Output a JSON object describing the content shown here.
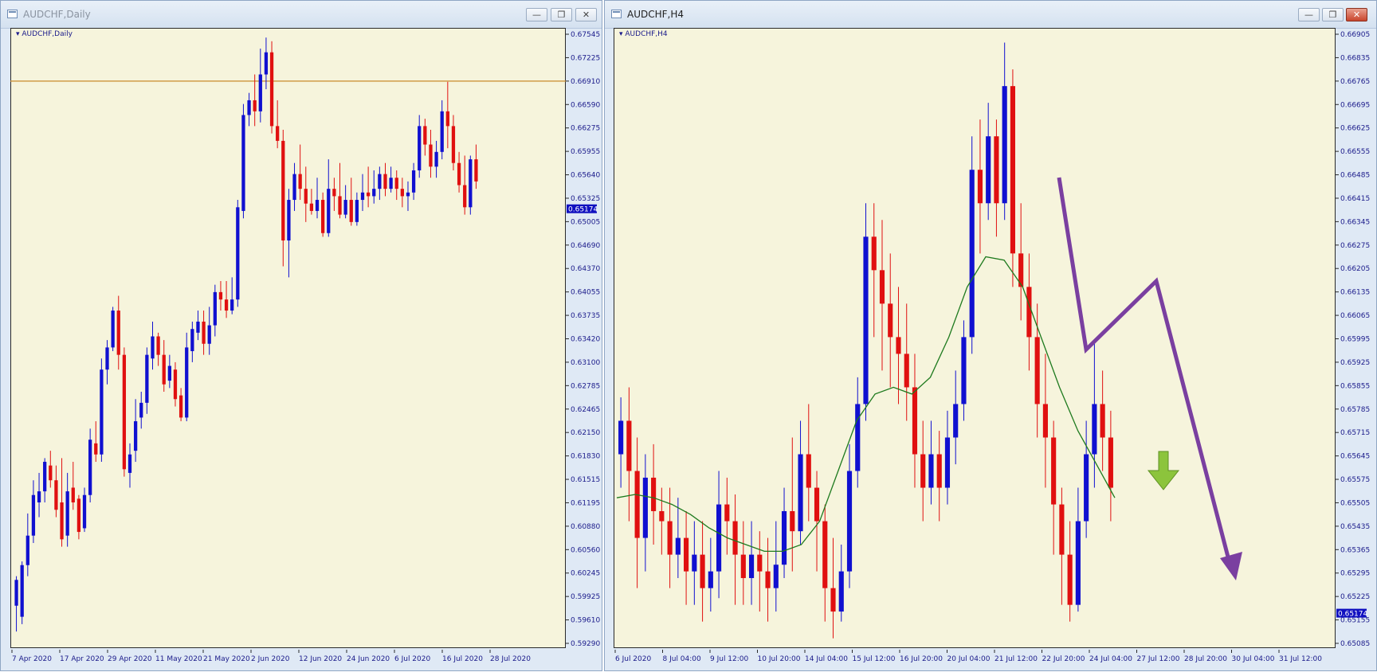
{
  "windows": {
    "left": {
      "title": "AUDCHF,Daily",
      "chart_label": "AUDCHF,Daily",
      "controls": [
        "minimize",
        "restore",
        "close"
      ]
    },
    "right": {
      "title": "AUDCHF,H4",
      "chart_label": "AUDCHF,H4",
      "controls": [
        "minimize",
        "restore",
        "close"
      ]
    }
  },
  "colors": {
    "background": "#f6f4dc",
    "bull_candle": "#1010d0",
    "bear_candle": "#e01010",
    "moving_average": "#1e7a1e",
    "annotation_arrow": "#7a3fa0",
    "signal_arrow": "#8cc43c",
    "horizontal_line": "#c98a2a",
    "price_tag": "#1010c0"
  },
  "chart_data": [
    {
      "type": "candlestick",
      "title": "AUDCHF,Daily",
      "price_axis": [
        "0.67545",
        "0.67225",
        "0.66910",
        "0.66590",
        "0.66275",
        "0.65955",
        "0.65640",
        "0.65325",
        "0.65005",
        "0.64690",
        "0.64370",
        "0.64055",
        "0.63735",
        "0.63420",
        "0.63100",
        "0.62785",
        "0.62465",
        "0.62150",
        "0.61830",
        "0.61515",
        "0.61195",
        "0.60880",
        "0.60560",
        "0.60245",
        "0.59925",
        "0.59610",
        "0.59290"
      ],
      "date_axis": [
        "7 Apr 2020",
        "17 Apr 2020",
        "29 Apr 2020",
        "11 May 2020",
        "21 May 2020",
        "2 Jun 2020",
        "12 Jun 2020",
        "24 Jun 2020",
        "6 Jul 2020",
        "16 Jul 2020",
        "28 Jul 2020"
      ],
      "ylim": [
        0.5929,
        0.67545
      ],
      "current_price": "0.65174",
      "horizontal_line": 0.6691,
      "candles": [
        [
          0.598,
          0.6015,
          0.5945,
          0.602,
          "up"
        ],
        [
          0.5965,
          0.6035,
          0.5955,
          0.604,
          "up"
        ],
        [
          0.6035,
          0.6075,
          0.602,
          0.6105,
          "up"
        ],
        [
          0.6075,
          0.613,
          0.6065,
          0.615,
          "up"
        ],
        [
          0.612,
          0.6135,
          0.61,
          0.616,
          "up"
        ],
        [
          0.6135,
          0.6175,
          0.612,
          0.618,
          "up"
        ],
        [
          0.617,
          0.615,
          0.614,
          0.619,
          "down"
        ],
        [
          0.615,
          0.611,
          0.61,
          0.617,
          "down"
        ],
        [
          0.612,
          0.607,
          0.606,
          0.618,
          "down"
        ],
        [
          0.6075,
          0.6135,
          0.606,
          0.616,
          "up"
        ],
        [
          0.614,
          0.612,
          0.611,
          0.6175,
          "down"
        ],
        [
          0.6125,
          0.608,
          0.607,
          0.613,
          "down"
        ],
        [
          0.6085,
          0.613,
          0.608,
          0.614,
          "up"
        ],
        [
          0.613,
          0.6205,
          0.612,
          0.622,
          "up"
        ],
        [
          0.62,
          0.6185,
          0.6175,
          0.623,
          "down"
        ],
        [
          0.6185,
          0.63,
          0.6175,
          0.6315,
          "up"
        ],
        [
          0.63,
          0.633,
          0.628,
          0.634,
          "up"
        ],
        [
          0.633,
          0.638,
          0.6325,
          0.6385,
          "up"
        ],
        [
          0.638,
          0.632,
          0.63,
          0.64,
          "down"
        ],
        [
          0.632,
          0.6165,
          0.6155,
          0.633,
          "down"
        ],
        [
          0.616,
          0.6185,
          0.614,
          0.62,
          "up"
        ],
        [
          0.619,
          0.623,
          0.6175,
          0.626,
          "up"
        ],
        [
          0.6235,
          0.6255,
          0.622,
          0.627,
          "up"
        ],
        [
          0.6255,
          0.632,
          0.624,
          0.633,
          "up"
        ],
        [
          0.6315,
          0.6345,
          0.63,
          0.6365,
          "up"
        ],
        [
          0.6345,
          0.632,
          0.6305,
          0.635,
          "down"
        ],
        [
          0.632,
          0.628,
          0.627,
          0.634,
          "down"
        ],
        [
          0.6285,
          0.6305,
          0.6275,
          0.632,
          "up"
        ],
        [
          0.63,
          0.626,
          0.625,
          0.631,
          "down"
        ],
        [
          0.6265,
          0.6235,
          0.623,
          0.6275,
          "down"
        ],
        [
          0.6235,
          0.633,
          0.623,
          0.635,
          "up"
        ],
        [
          0.6325,
          0.6355,
          0.631,
          0.6365,
          "up"
        ],
        [
          0.635,
          0.6365,
          0.634,
          0.638,
          "up"
        ],
        [
          0.6365,
          0.6335,
          0.632,
          0.638,
          "down"
        ],
        [
          0.6335,
          0.636,
          0.632,
          0.6385,
          "up"
        ],
        [
          0.636,
          0.6405,
          0.6345,
          0.6415,
          "up"
        ],
        [
          0.6405,
          0.6395,
          0.638,
          0.642,
          "down"
        ],
        [
          0.6395,
          0.638,
          0.637,
          0.642,
          "down"
        ],
        [
          0.638,
          0.6395,
          0.6375,
          0.6425,
          "up"
        ],
        [
          0.6395,
          0.652,
          0.6385,
          0.653,
          "up"
        ],
        [
          0.6515,
          0.6645,
          0.6505,
          0.666,
          "up"
        ],
        [
          0.6645,
          0.6665,
          0.663,
          0.6675,
          "up"
        ],
        [
          0.6665,
          0.665,
          0.663,
          0.67,
          "down"
        ],
        [
          0.665,
          0.67,
          0.6635,
          0.6735,
          "up"
        ],
        [
          0.67,
          0.673,
          0.668,
          0.675,
          "up"
        ],
        [
          0.673,
          0.663,
          0.662,
          0.6745,
          "down"
        ],
        [
          0.663,
          0.661,
          0.66,
          0.6665,
          "down"
        ],
        [
          0.661,
          0.6475,
          0.644,
          0.6625,
          "down"
        ],
        [
          0.6475,
          0.653,
          0.6425,
          0.6545,
          "up"
        ],
        [
          0.653,
          0.6565,
          0.6515,
          0.658,
          "up"
        ],
        [
          0.6565,
          0.6545,
          0.653,
          0.6605,
          "down"
        ],
        [
          0.6545,
          0.6525,
          0.65,
          0.6575,
          "down"
        ],
        [
          0.6525,
          0.6515,
          0.651,
          0.6545,
          "down"
        ],
        [
          0.6515,
          0.653,
          0.6505,
          0.656,
          "up"
        ],
        [
          0.653,
          0.6485,
          0.648,
          0.654,
          "down"
        ],
        [
          0.6485,
          0.6545,
          0.648,
          0.6585,
          "up"
        ],
        [
          0.6545,
          0.6535,
          0.6515,
          0.656,
          "down"
        ],
        [
          0.6535,
          0.651,
          0.6505,
          0.658,
          "down"
        ],
        [
          0.651,
          0.653,
          0.6505,
          0.655,
          "up"
        ],
        [
          0.653,
          0.65,
          0.6495,
          0.656,
          "down"
        ],
        [
          0.65,
          0.653,
          0.6495,
          0.654,
          "up"
        ],
        [
          0.653,
          0.654,
          0.6515,
          0.6565,
          "up"
        ],
        [
          0.654,
          0.6535,
          0.652,
          0.6575,
          "down"
        ],
        [
          0.6535,
          0.6545,
          0.6525,
          0.657,
          "up"
        ],
        [
          0.6545,
          0.6565,
          0.653,
          0.6575,
          "up"
        ],
        [
          0.6565,
          0.6545,
          0.6535,
          0.658,
          "down"
        ],
        [
          0.6545,
          0.656,
          0.654,
          0.6575,
          "up"
        ],
        [
          0.656,
          0.6545,
          0.653,
          0.657,
          "down"
        ],
        [
          0.6545,
          0.6535,
          0.652,
          0.656,
          "down"
        ],
        [
          0.6535,
          0.654,
          0.6515,
          0.6555,
          "up"
        ],
        [
          0.654,
          0.657,
          0.653,
          0.658,
          "up"
        ],
        [
          0.657,
          0.663,
          0.656,
          0.6645,
          "up"
        ],
        [
          0.663,
          0.6605,
          0.659,
          0.664,
          "down"
        ],
        [
          0.6605,
          0.6575,
          0.656,
          0.6625,
          "down"
        ],
        [
          0.6575,
          0.6595,
          0.656,
          0.661,
          "up"
        ],
        [
          0.6595,
          0.665,
          0.6585,
          0.6665,
          "up"
        ],
        [
          0.665,
          0.663,
          0.66,
          0.669,
          "down"
        ],
        [
          0.663,
          0.658,
          0.657,
          0.6645,
          "down"
        ],
        [
          0.658,
          0.655,
          0.654,
          0.6595,
          "down"
        ],
        [
          0.655,
          0.652,
          0.651,
          0.659,
          "down"
        ],
        [
          0.652,
          0.6585,
          0.651,
          0.659,
          "up"
        ],
        [
          0.6585,
          0.6555,
          0.6545,
          0.6605,
          "down"
        ]
      ]
    },
    {
      "type": "candlestick",
      "title": "AUDCHF,H4",
      "price_axis": [
        "0.66905",
        "0.66835",
        "0.66765",
        "0.66695",
        "0.66625",
        "0.66555",
        "0.66485",
        "0.66415",
        "0.66345",
        "0.66275",
        "0.66205",
        "0.66135",
        "0.66065",
        "0.65995",
        "0.65925",
        "0.65855",
        "0.65785",
        "0.65715",
        "0.65645",
        "0.65575",
        "0.65505",
        "0.65435",
        "0.65365",
        "0.65295",
        "0.65225",
        "0.65155",
        "0.65085"
      ],
      "date_axis": [
        "6 Jul 2020",
        "8 Jul 04:00",
        "9 Jul 12:00",
        "10 Jul 20:00",
        "14 Jul 04:00",
        "15 Jul 12:00",
        "16 Jul 20:00",
        "20 Jul 04:00",
        "21 Jul 12:00",
        "22 Jul 20:00",
        "24 Jul 04:00",
        "27 Jul 12:00",
        "28 Jul 20:00",
        "30 Jul 04:00",
        "31 Jul 12:00"
      ],
      "ylim": [
        0.65085,
        0.66905
      ],
      "current_price": "0.65174",
      "candles": [
        [
          0.6565,
          0.6575,
          0.6555,
          0.6582,
          "up"
        ],
        [
          0.6575,
          0.656,
          0.6545,
          0.6585,
          "down"
        ],
        [
          0.656,
          0.654,
          0.6525,
          0.657,
          "down"
        ],
        [
          0.654,
          0.6558,
          0.653,
          0.6565,
          "up"
        ],
        [
          0.6558,
          0.6548,
          0.6538,
          0.6568,
          "down"
        ],
        [
          0.6548,
          0.6545,
          0.6535,
          0.6555,
          "down"
        ],
        [
          0.6545,
          0.6535,
          0.6525,
          0.6555,
          "down"
        ],
        [
          0.6535,
          0.654,
          0.6528,
          0.6552,
          "up"
        ],
        [
          0.654,
          0.653,
          0.652,
          0.6548,
          "down"
        ],
        [
          0.653,
          0.6535,
          0.652,
          0.6545,
          "up"
        ],
        [
          0.6535,
          0.6525,
          0.6515,
          0.6545,
          "down"
        ],
        [
          0.6525,
          0.653,
          0.6518,
          0.654,
          "up"
        ],
        [
          0.653,
          0.655,
          0.6522,
          0.656,
          "up"
        ],
        [
          0.655,
          0.6545,
          0.6535,
          0.6558,
          "down"
        ],
        [
          0.6545,
          0.6535,
          0.652,
          0.6553,
          "down"
        ],
        [
          0.6535,
          0.6528,
          0.652,
          0.6545,
          "down"
        ],
        [
          0.6528,
          0.6535,
          0.652,
          0.6545,
          "up"
        ],
        [
          0.6535,
          0.653,
          0.6518,
          0.6542,
          "down"
        ],
        [
          0.653,
          0.6525,
          0.6515,
          0.654,
          "down"
        ],
        [
          0.6525,
          0.6532,
          0.6518,
          0.6545,
          "up"
        ],
        [
          0.6532,
          0.6548,
          0.6528,
          0.6555,
          "up"
        ],
        [
          0.6548,
          0.6542,
          0.653,
          0.657,
          "down"
        ],
        [
          0.6542,
          0.6565,
          0.6538,
          0.6575,
          "up"
        ],
        [
          0.6565,
          0.6555,
          0.6545,
          0.658,
          "down"
        ],
        [
          0.6555,
          0.6545,
          0.653,
          0.656,
          "down"
        ],
        [
          0.6545,
          0.6525,
          0.6515,
          0.655,
          "down"
        ],
        [
          0.6525,
          0.6518,
          0.651,
          0.654,
          "down"
        ],
        [
          0.6518,
          0.653,
          0.6515,
          0.6538,
          "up"
        ],
        [
          0.653,
          0.656,
          0.6525,
          0.6568,
          "up"
        ],
        [
          0.656,
          0.658,
          0.6555,
          0.6588,
          "up"
        ],
        [
          0.658,
          0.663,
          0.6575,
          0.664,
          "up"
        ],
        [
          0.663,
          0.662,
          0.66,
          0.664,
          "down"
        ],
        [
          0.662,
          0.661,
          0.659,
          0.6635,
          "down"
        ],
        [
          0.661,
          0.66,
          0.6585,
          0.6625,
          "down"
        ],
        [
          0.66,
          0.6595,
          0.658,
          0.6615,
          "down"
        ],
        [
          0.6595,
          0.6585,
          0.6575,
          0.661,
          "down"
        ],
        [
          0.6585,
          0.6565,
          0.6555,
          0.6595,
          "down"
        ],
        [
          0.6565,
          0.6555,
          0.6545,
          0.6575,
          "down"
        ],
        [
          0.6555,
          0.6565,
          0.655,
          0.6575,
          "up"
        ],
        [
          0.6565,
          0.6555,
          0.6545,
          0.6572,
          "down"
        ],
        [
          0.6555,
          0.657,
          0.655,
          0.6578,
          "up"
        ],
        [
          0.657,
          0.658,
          0.6562,
          0.659,
          "up"
        ],
        [
          0.658,
          0.66,
          0.6575,
          0.6605,
          "up"
        ],
        [
          0.66,
          0.665,
          0.6595,
          0.666,
          "up"
        ],
        [
          0.665,
          0.664,
          0.6625,
          0.6665,
          "down"
        ],
        [
          0.664,
          0.666,
          0.6635,
          0.667,
          "up"
        ],
        [
          0.666,
          0.664,
          0.663,
          0.6665,
          "down"
        ],
        [
          0.664,
          0.6675,
          0.6635,
          0.6688,
          "up"
        ],
        [
          0.6675,
          0.6625,
          0.6615,
          0.668,
          "down"
        ],
        [
          0.6625,
          0.6615,
          0.6605,
          0.664,
          "down"
        ],
        [
          0.6615,
          0.66,
          0.659,
          0.6625,
          "down"
        ],
        [
          0.66,
          0.658,
          0.657,
          0.661,
          "down"
        ],
        [
          0.658,
          0.657,
          0.6555,
          0.6595,
          "down"
        ],
        [
          0.657,
          0.655,
          0.6535,
          0.6575,
          "down"
        ],
        [
          0.655,
          0.6535,
          0.652,
          0.6555,
          "down"
        ],
        [
          0.6535,
          0.652,
          0.6515,
          0.6545,
          "down"
        ],
        [
          0.652,
          0.6545,
          0.6518,
          0.6555,
          "up"
        ],
        [
          0.6545,
          0.6565,
          0.654,
          0.6575,
          "up"
        ],
        [
          0.6565,
          0.658,
          0.6555,
          0.6598,
          "up"
        ],
        [
          0.658,
          0.657,
          0.656,
          0.659,
          "down"
        ],
        [
          0.657,
          0.6555,
          0.6545,
          0.6578,
          "down"
        ]
      ],
      "moving_average": [
        0.6552,
        0.6553,
        0.6552,
        0.655,
        0.6547,
        0.6543,
        0.654,
        0.6538,
        0.6536,
        0.6536,
        0.6538,
        0.6545,
        0.656,
        0.6575,
        0.6583,
        0.6585,
        0.6583,
        0.6588,
        0.66,
        0.6615,
        0.6624,
        0.6623,
        0.6615,
        0.66,
        0.6585,
        0.6572,
        0.6562,
        0.6552
      ]
    }
  ]
}
